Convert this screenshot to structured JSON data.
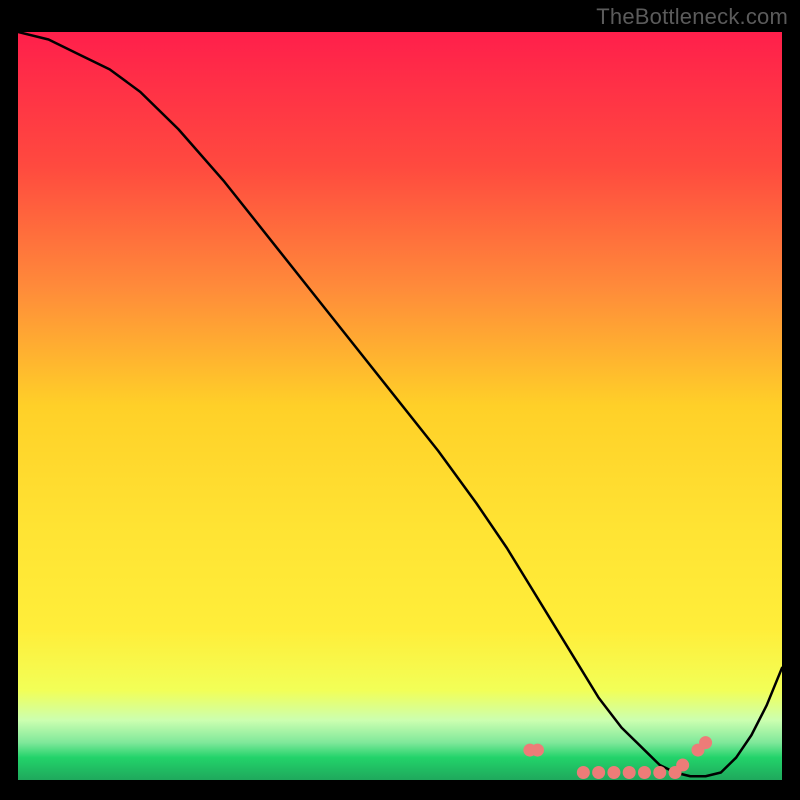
{
  "watermark": "TheBottleneck.com",
  "colors": {
    "bg": "#000000",
    "curve": "#000000",
    "dots": "#ed7c78",
    "grad_top": "#ff1f4b",
    "grad_upper_mid": "#ff8a3a",
    "grad_mid": "#ffd028",
    "grad_lower_mid": "#ffee3a",
    "grad_pre_green": "#f2ff57",
    "grad_pale": "#ccffb0",
    "grad_green": "#22d36a",
    "grad_bottom": "#1fa85c"
  },
  "chart_data": {
    "type": "line",
    "title": "",
    "xlabel": "",
    "ylabel": "",
    "xlim": [
      0,
      100
    ],
    "ylim": [
      0,
      100
    ],
    "x": [
      0,
      4,
      8,
      12,
      16,
      21,
      27,
      34,
      41,
      48,
      55,
      60,
      64,
      67,
      70,
      73,
      76,
      79,
      82,
      84,
      86,
      88,
      90,
      92,
      94,
      96,
      98,
      100
    ],
    "values": [
      100,
      99,
      97,
      95,
      92,
      87,
      80,
      71,
      62,
      53,
      44,
      37,
      31,
      26,
      21,
      16,
      11,
      7,
      4,
      2,
      1,
      0.5,
      0.5,
      1,
      3,
      6,
      10,
      15
    ],
    "dots_x": [
      67,
      68,
      74,
      76,
      78,
      80,
      82,
      84,
      86,
      87,
      89,
      90
    ],
    "dots_y": [
      4,
      4,
      1,
      1,
      1,
      1,
      1,
      1,
      1,
      2,
      4,
      5
    ]
  }
}
